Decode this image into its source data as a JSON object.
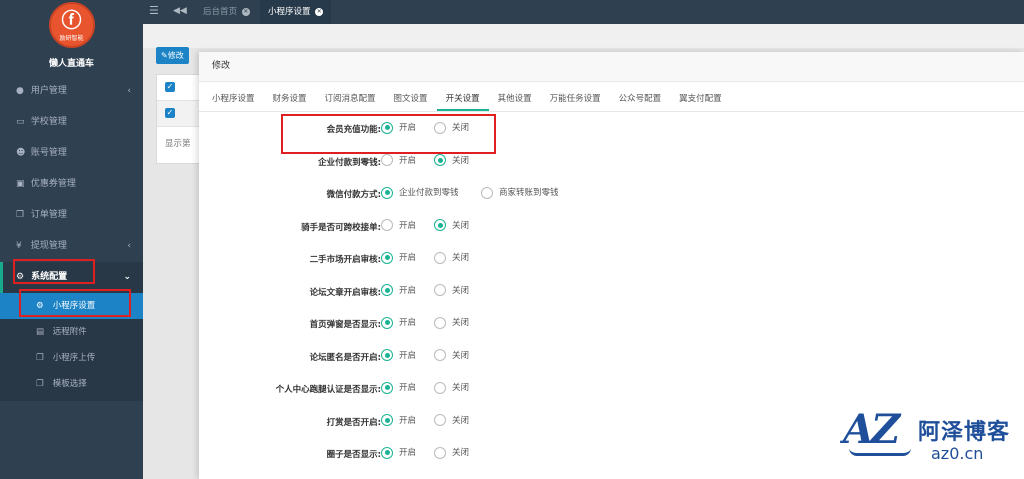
{
  "brand": {
    "logo_text": "励研智能",
    "profile_name": "懒人直通车"
  },
  "sidebar": {
    "items": [
      {
        "label": "用户管理",
        "icon": "user-icon",
        "has_arrow": true
      },
      {
        "label": "学校管理",
        "icon": "school-icon",
        "has_arrow": false
      },
      {
        "label": "账号管理",
        "icon": "users-icon",
        "has_arrow": false
      },
      {
        "label": "优惠券管理",
        "icon": "coupon-icon",
        "has_arrow": false
      },
      {
        "label": "订单管理",
        "icon": "order-icon",
        "has_arrow": false
      },
      {
        "label": "提现管理",
        "icon": "yen-icon",
        "has_arrow": true
      },
      {
        "label": "系统配置",
        "icon": "gear-icon",
        "has_arrow": true
      }
    ],
    "subitems": [
      {
        "label": "小程序设置",
        "icon": "gear-icon"
      },
      {
        "label": "远程附件",
        "icon": "image-icon"
      },
      {
        "label": "小程序上传",
        "icon": "copy-icon"
      },
      {
        "label": "模板选择",
        "icon": "copy-icon"
      }
    ]
  },
  "topbar": {
    "tabs": [
      {
        "label": "后台首页"
      },
      {
        "label": "小程序设置"
      }
    ]
  },
  "background": {
    "edit_button": "修改",
    "partial_text": "显示第"
  },
  "modal": {
    "title": "修改",
    "tabs": [
      "小程序设置",
      "财务设置",
      "订阅消息配置",
      "图文设置",
      "开关设置",
      "其他设置",
      "万能任务设置",
      "公众号配置",
      "翼支付配置"
    ],
    "active_tab": "开关设置",
    "rows": [
      {
        "label": "会员充值功能:",
        "options": [
          "开启",
          "关闭"
        ],
        "selected": 0
      },
      {
        "label": "企业付款到零钱:",
        "options": [
          "开启",
          "关闭"
        ],
        "selected": 1
      },
      {
        "label": "微信付款方式:",
        "options": [
          "企业付款到零钱",
          "商家转账到零钱"
        ],
        "selected": 0
      },
      {
        "label": "骑手是否可跨校接单:",
        "options": [
          "开启",
          "关闭"
        ],
        "selected": 1
      },
      {
        "label": "二手市场开启审核:",
        "options": [
          "开启",
          "关闭"
        ],
        "selected": 0
      },
      {
        "label": "论坛文章开启审核:",
        "options": [
          "开启",
          "关闭"
        ],
        "selected": 0
      },
      {
        "label": "首页弹窗是否显示:",
        "options": [
          "开启",
          "关闭"
        ],
        "selected": 0
      },
      {
        "label": "论坛匿名是否开启:",
        "options": [
          "开启",
          "关闭"
        ],
        "selected": 0
      },
      {
        "label": "个人中心跑腿认证是否显示:",
        "options": [
          "开启",
          "关闭"
        ],
        "selected": 0
      },
      {
        "label": "打赏是否开启:",
        "options": [
          "开启",
          "关闭"
        ],
        "selected": 0
      },
      {
        "label": "圈子是否显示:",
        "options": [
          "开启",
          "关闭"
        ],
        "selected": 0
      }
    ]
  },
  "watermark": {
    "logo": "AZ",
    "name": "阿泽博客",
    "url": "az0.cn"
  },
  "colors": {
    "sidebar_bg": "#2f4050",
    "accent_green": "#1ab394",
    "accent_blue": "#1c84c6",
    "highlight_red": "#e02020"
  }
}
